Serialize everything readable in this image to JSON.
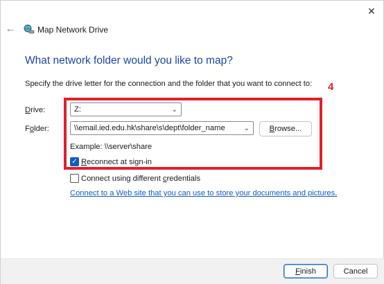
{
  "window": {
    "title": "Map Network Drive",
    "close_glyph": "✕",
    "back_glyph": "←"
  },
  "main": {
    "heading": "What network folder would you like to map?",
    "instructions": "Specify the drive letter for the connection and the folder that you want to connect to:",
    "annotation_number": "4",
    "drive": {
      "label_pre": "",
      "label_access": "D",
      "label_post": "rive:",
      "value": "Z:"
    },
    "folder": {
      "label_pre": "F",
      "label_access": "o",
      "label_post": "lder:",
      "value": "\\\\email.ied.edu.hk\\share\\s\\dept\\folder_name",
      "browse_pre": "",
      "browse_access": "B",
      "browse_post": "rowse..."
    },
    "example": "Example: \\\\server\\share",
    "reconnect": {
      "label_pre": "",
      "label_access": "R",
      "label_post": "econnect at sign-in",
      "checked": true
    },
    "credentials": {
      "label_pre": "Connect using different ",
      "label_access": "c",
      "label_post": "redentials",
      "checked": false
    },
    "link": "Connect to a Web site that you can use to store your documents and pictures",
    "link_suffix": "."
  },
  "footer": {
    "finish": {
      "pre": "",
      "access": "F",
      "post": "inish"
    },
    "cancel": "Cancel"
  },
  "colors": {
    "heading": "#1a47a3",
    "annotation": "#e0202c",
    "accent": "#0f5cc4"
  },
  "icons": {
    "app": "network-drive-icon",
    "dropdown": "chevron-down-icon"
  }
}
